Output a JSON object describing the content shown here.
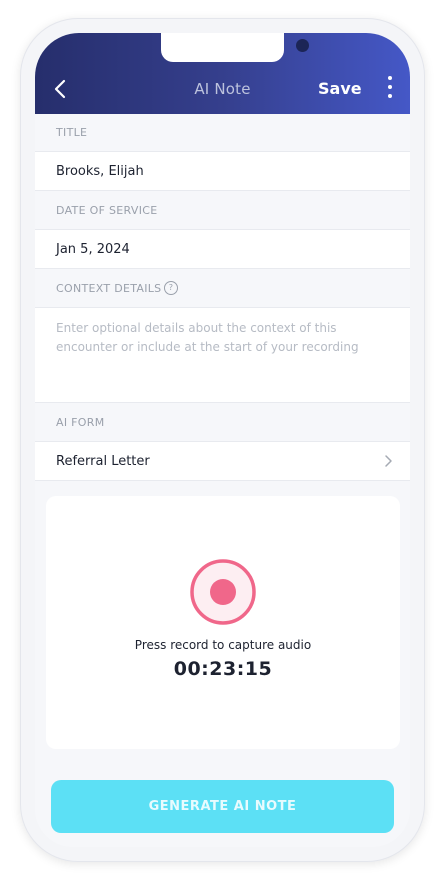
{
  "header": {
    "title": "AI Note",
    "save_label": "Save",
    "gradient_start": "#262e6c",
    "gradient_end": "#4558c7"
  },
  "fields": {
    "title_label": "TITLE",
    "title_value": "Brooks, Elijah",
    "date_label": "DATE OF SERVICE",
    "date_value": "Jan 5, 2024",
    "context_label": "CONTEXT DETAILS",
    "context_help_icon": "?",
    "context_placeholder": "Enter optional details about the context of this encounter or include at the start of your recording",
    "form_label": "AI FORM",
    "form_value": "Referral Letter"
  },
  "recorder": {
    "hint": "Press record to capture audio",
    "timer": "00:23:15",
    "record_color": "#f0678a"
  },
  "footer": {
    "generate_label": "GENERATE AI NOTE",
    "button_color": "#5ce0f5"
  }
}
